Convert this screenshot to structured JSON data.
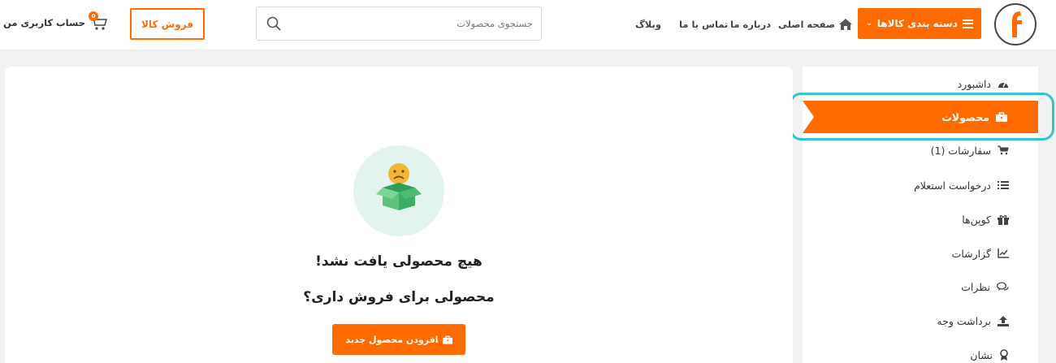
{
  "header": {
    "logo_icon": "f-logo",
    "categories_label": "دسته بندی کالاها",
    "nav": {
      "home": "صفحه اصلی",
      "about": "درباره ما",
      "contact": "تماس با ما",
      "blog": "وبلاگ"
    },
    "search": {
      "placeholder": "جستجوی محصولات",
      "value": ""
    },
    "sell_label": "فروش کالا",
    "cart_count": "0",
    "account_label": "حساب کاربری من"
  },
  "sidebar": {
    "items": [
      {
        "label": "داشبورد",
        "icon": "dashboard-icon"
      },
      {
        "label": "محصولات",
        "icon": "briefcase-icon",
        "active": true
      },
      {
        "label": "سفارشات (1)",
        "icon": "cart-icon"
      },
      {
        "label": "درخواست استعلام",
        "icon": "list-icon"
      },
      {
        "label": "کوپن‌ها",
        "icon": "gift-icon"
      },
      {
        "label": "گزارشات",
        "icon": "chart-icon"
      },
      {
        "label": "نظرات",
        "icon": "comments-icon"
      },
      {
        "label": "برداشت وجه",
        "icon": "upload-icon"
      },
      {
        "label": "نشان",
        "icon": "badge-icon"
      }
    ]
  },
  "main": {
    "empty_title": "هیچ محصولی یافت نشد!",
    "empty_subtitle": "محصولی برای فروش داری؟",
    "add_button_label": "افزودن محصول جدید"
  },
  "colors": {
    "accent": "#ff6b00",
    "highlight": "#35c2c9",
    "illustration_bg": "#e3f4ef"
  }
}
